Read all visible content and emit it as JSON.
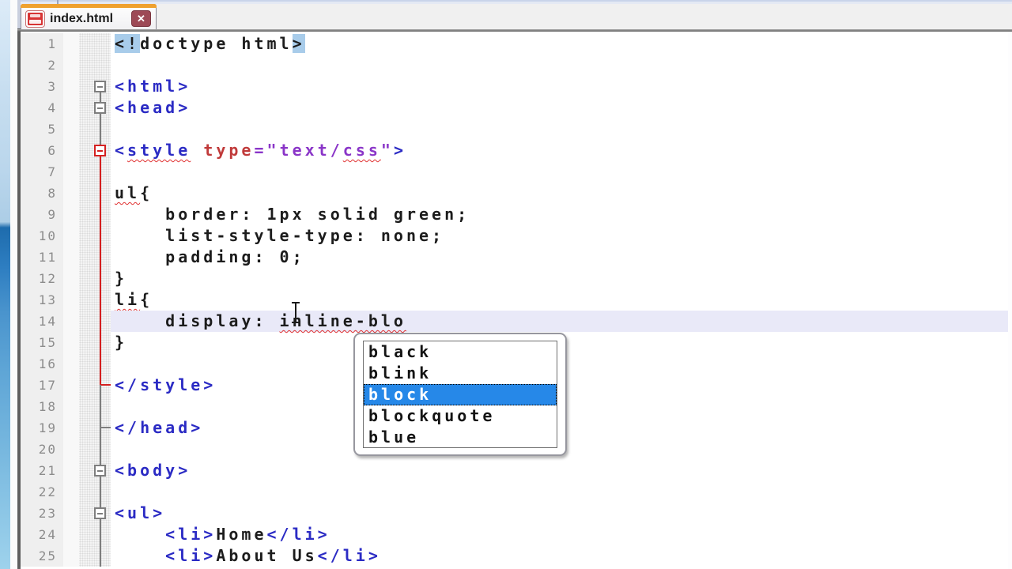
{
  "app": "notepad-plus-plus-editor",
  "tab_bar": {
    "tabs": [
      {
        "label": "index.html",
        "modified": true,
        "close_glyph": "✕",
        "status_icon": "unsaved-floppy-icon"
      }
    ]
  },
  "colors": {
    "tag_blue": "#2B2BC4",
    "attr_red": "#C03A3A",
    "value_purple": "#8A35C8",
    "code_black": "#1C1C1C",
    "line_number_gray": "#8C8C8C",
    "fold_gray": "#7E7E7E",
    "fold_red": "#D42020",
    "current_line_bg": "#E9E9F8",
    "match_highlight_bg": "#A8CCEA",
    "squiggle_red": "#E03030",
    "selection_blue": "#2688E8",
    "tab_orange": "#EFA12F",
    "close_maroon": "#9D4A56",
    "floppy_red": "#D83434"
  },
  "editor": {
    "language": "html",
    "current_line": 14,
    "lines": [
      {
        "n": 1,
        "tokens": [
          {
            "t": "<!",
            "c": "hl"
          },
          {
            "t": "doctype html",
            "c": "b"
          },
          {
            "t": ">",
            "c": "hl"
          }
        ]
      },
      {
        "n": 2
      },
      {
        "n": 3,
        "fold": {
          "box": "g",
          "bot": "g"
        },
        "tokens": [
          {
            "t": "<html>",
            "c": "t"
          }
        ]
      },
      {
        "n": 4,
        "fold": {
          "top": "g",
          "box": "g",
          "bot": "g"
        },
        "tokens": [
          {
            "t": "<head>",
            "c": "t"
          }
        ]
      },
      {
        "n": 5,
        "fold": {
          "top": "g",
          "bot": "g"
        }
      },
      {
        "n": 6,
        "fold": {
          "top": "g",
          "box": "r",
          "bot": "r"
        },
        "tokens": [
          {
            "t": "<",
            "c": "t"
          },
          {
            "t": "style",
            "c": "t",
            "u": true
          },
          {
            "t": " ",
            "c": "b"
          },
          {
            "t": "type",
            "c": "a"
          },
          {
            "t": "=\"text/",
            "c": "v"
          },
          {
            "t": "css",
            "c": "v",
            "u": true
          },
          {
            "t": "\"",
            "c": "v"
          },
          {
            "t": ">",
            "c": "t"
          }
        ]
      },
      {
        "n": 7,
        "fold": {
          "top": "r",
          "bot": "r"
        }
      },
      {
        "n": 8,
        "fold": {
          "top": "r",
          "bot": "r"
        },
        "tokens": [
          {
            "t": "ul",
            "c": "b",
            "u": true
          },
          {
            "t": "{",
            "c": "b"
          }
        ]
      },
      {
        "n": 9,
        "fold": {
          "top": "r",
          "bot": "r"
        },
        "tokens": [
          {
            "t": "    border: 1px solid green;",
            "c": "b"
          }
        ]
      },
      {
        "n": 10,
        "fold": {
          "top": "r",
          "bot": "r"
        },
        "tokens": [
          {
            "t": "    list-style-type: none;",
            "c": "b"
          }
        ]
      },
      {
        "n": 11,
        "fold": {
          "top": "r",
          "bot": "r"
        },
        "tokens": [
          {
            "t": "    padding: 0;",
            "c": "b"
          }
        ]
      },
      {
        "n": 12,
        "fold": {
          "top": "r",
          "bot": "r"
        },
        "tokens": [
          {
            "t": "}",
            "c": "b"
          }
        ]
      },
      {
        "n": 13,
        "fold": {
          "top": "r",
          "bot": "r"
        },
        "tokens": [
          {
            "t": "li",
            "c": "b",
            "u": true
          },
          {
            "t": "{",
            "c": "b"
          }
        ]
      },
      {
        "n": 14,
        "cur": true,
        "fold": {
          "top": "r",
          "bot": "r"
        },
        "tokens": [
          {
            "t": "    display: ",
            "c": "b"
          },
          {
            "t": "inline-blo",
            "c": "b",
            "u": true
          }
        ]
      },
      {
        "n": 15,
        "fold": {
          "top": "r",
          "bot": "r"
        },
        "tokens": [
          {
            "t": "}",
            "c": "b"
          }
        ]
      },
      {
        "n": 16,
        "fold": {
          "top": "r",
          "bot": "r"
        }
      },
      {
        "n": 17,
        "fold": {
          "top": "r",
          "tick": "r",
          "bot": "g"
        },
        "tokens": [
          {
            "t": "</style>",
            "c": "t"
          }
        ]
      },
      {
        "n": 18,
        "fold": {
          "top": "g",
          "bot": "g"
        }
      },
      {
        "n": 19,
        "fold": {
          "top": "g",
          "tick": "g",
          "bot": "g"
        },
        "tokens": [
          {
            "t": "</head>",
            "c": "t"
          }
        ]
      },
      {
        "n": 20,
        "fold": {
          "top": "g",
          "bot": "g"
        }
      },
      {
        "n": 21,
        "fold": {
          "top": "g",
          "box": "g",
          "bot": "g"
        },
        "tokens": [
          {
            "t": "<body>",
            "c": "t"
          }
        ]
      },
      {
        "n": 22,
        "fold": {
          "top": "g",
          "bot": "g"
        }
      },
      {
        "n": 23,
        "fold": {
          "top": "g",
          "box": "g",
          "bot": "g"
        },
        "tokens": [
          {
            "t": "<ul>",
            "c": "t"
          }
        ]
      },
      {
        "n": 24,
        "fold": {
          "top": "g",
          "bot": "g"
        },
        "tokens": [
          {
            "t": "    ",
            "c": "b"
          },
          {
            "t": "<li>",
            "c": "t"
          },
          {
            "t": "Home",
            "c": "b"
          },
          {
            "t": "</li>",
            "c": "t"
          }
        ]
      },
      {
        "n": 25,
        "fold": {
          "top": "g",
          "bot": "g"
        },
        "tokens": [
          {
            "t": "    ",
            "c": "b"
          },
          {
            "t": "<li>",
            "c": "t"
          },
          {
            "t": "About Us",
            "c": "b"
          },
          {
            "t": "</li>",
            "c": "t"
          }
        ]
      }
    ]
  },
  "autocomplete": {
    "items": [
      "black",
      "blink",
      "block",
      "blockquote",
      "blue"
    ],
    "selected": "block",
    "selected_index": 2
  },
  "mouse_cursor": "i-beam"
}
